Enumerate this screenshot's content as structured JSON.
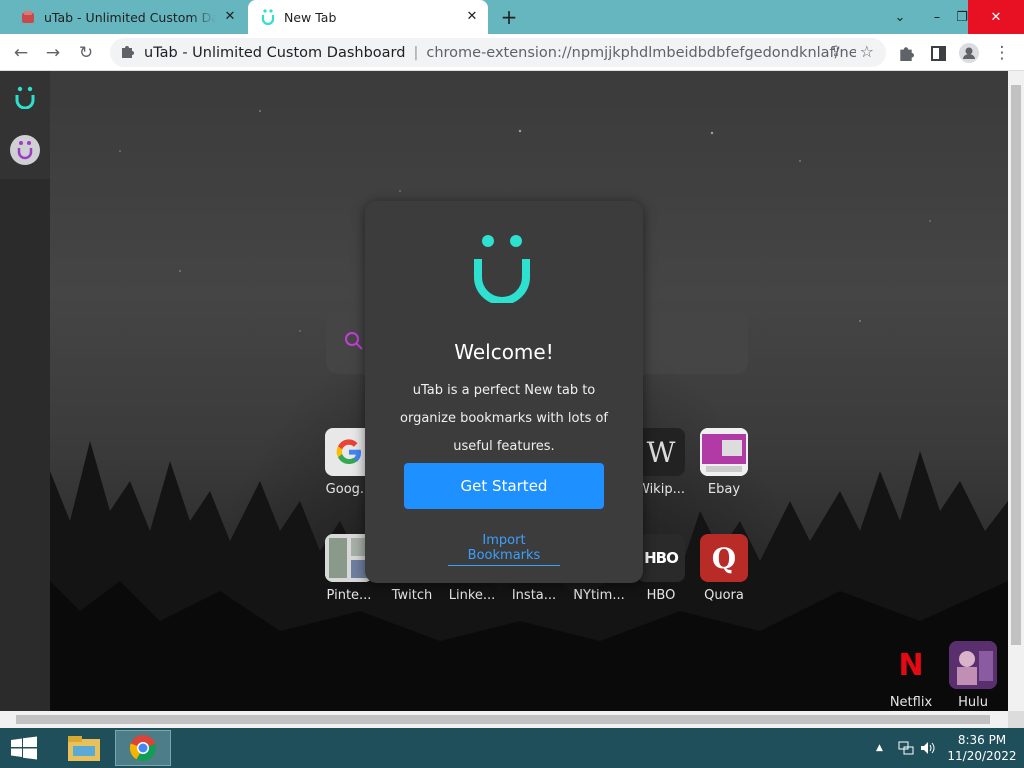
{
  "tabs": [
    {
      "title": "uTab - Unlimited Custom Dashboard"
    },
    {
      "title": "New Tab"
    }
  ],
  "window_controls": {
    "minimize": "⌄",
    "restore": "❐",
    "close": "✕"
  },
  "toolbar": {
    "omnibox_host": "uTab - Unlimited Custom Dashboard",
    "omnibox_url": "chrome-extension://npmjjkphdlmbeidbdbfefgedondknlaf/newtab.ht..."
  },
  "modal": {
    "title": "Welcome!",
    "description": "uTab is a perfect New tab to organize bookmarks with lots of useful features.",
    "primary_button": "Get Started",
    "secondary_link": "Import Bookmarks"
  },
  "shortcuts_row1": [
    {
      "label": "Goog...",
      "icon": "google-icon"
    },
    {
      "label": "Wikip...",
      "icon": "wikipedia-icon"
    },
    {
      "label": "Ebay",
      "icon": "ebay-icon"
    }
  ],
  "shortcuts_row2": [
    {
      "label": "Pinte...",
      "icon": "pinterest-icon"
    },
    {
      "label": "Twitch",
      "icon": "twitch-icon"
    },
    {
      "label": "Linke...",
      "icon": "linkedin-icon"
    },
    {
      "label": "Insta...",
      "icon": "instagram-icon"
    },
    {
      "label": "NYtim...",
      "icon": "nytimes-icon"
    },
    {
      "label": "HBO",
      "icon": "hbo-icon"
    },
    {
      "label": "Quora",
      "icon": "quora-icon"
    }
  ],
  "corner_shortcuts": [
    {
      "label": "Netflix",
      "icon": "netflix-icon"
    },
    {
      "label": "Hulu",
      "icon": "hulu-icon"
    }
  ],
  "taskbar": {
    "time": "8:36 PM",
    "date": "11/20/2022"
  },
  "colors": {
    "accent_teal": "#2ee0d0",
    "button_blue": "#1e90ff",
    "link_blue": "#3aa0ff",
    "tabbar": "#66b6bf"
  }
}
